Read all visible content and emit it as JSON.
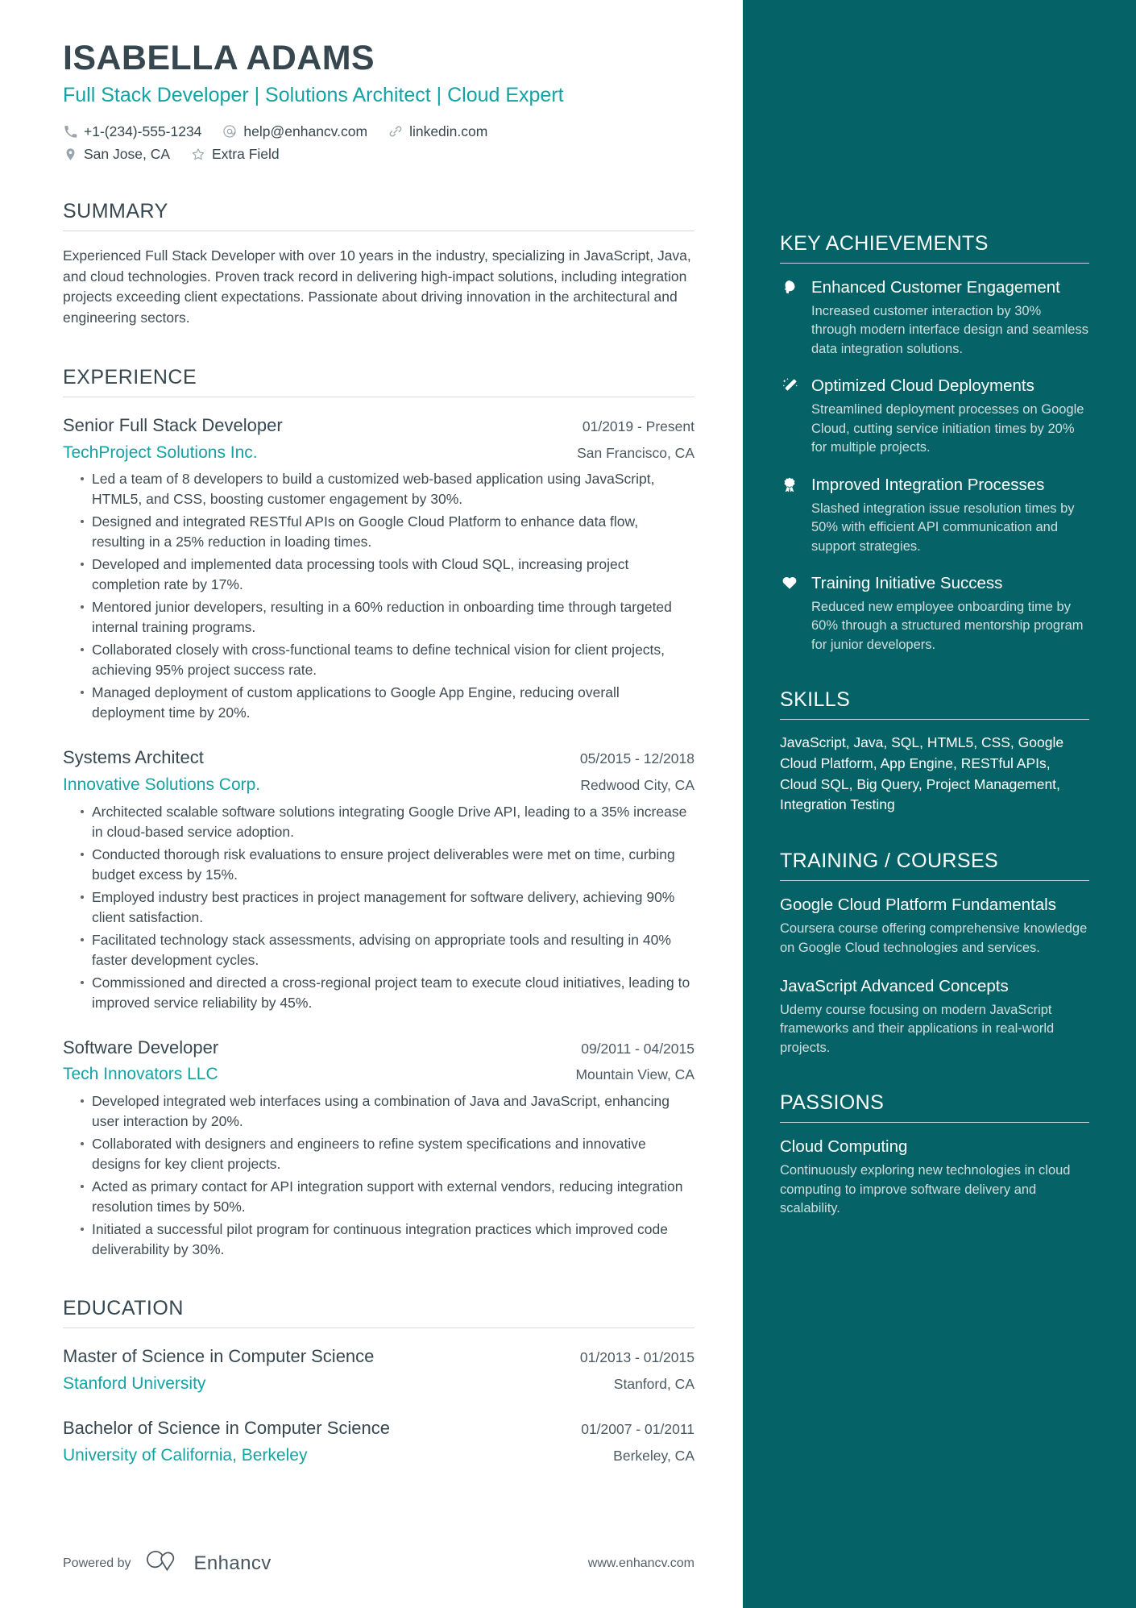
{
  "colors": {
    "accent_teal": "#14a3a3",
    "sidebar_bg": "#056367",
    "text_dark": "#37474f",
    "muted": "#cfdedd"
  },
  "header": {
    "name": "ISABELLA ADAMS",
    "headline": "Full Stack Developer | Solutions Architect | Cloud Expert",
    "contacts_row1": [
      {
        "icon": "phone-icon",
        "text": "+1-(234)-555-1234"
      },
      {
        "icon": "email-icon",
        "text": "help@enhancv.com"
      },
      {
        "icon": "link-icon",
        "text": "linkedin.com"
      }
    ],
    "contacts_row2": [
      {
        "icon": "location-icon",
        "text": "San Jose, CA"
      },
      {
        "icon": "star-icon",
        "text": "Extra Field"
      }
    ]
  },
  "summary": {
    "title": "SUMMARY",
    "text": "Experienced Full Stack Developer with over 10 years in the industry, specializing in JavaScript, Java, and cloud technologies. Proven track record in delivering high-impact solutions, including integration projects exceeding client expectations. Passionate about driving innovation in the architectural and engineering sectors."
  },
  "experience": {
    "title": "EXPERIENCE",
    "jobs": [
      {
        "title": "Senior Full Stack Developer",
        "dates": "01/2019 - Present",
        "company": "TechProject Solutions Inc.",
        "location": "San Francisco, CA",
        "bullets": [
          "Led a team of 8 developers to build a customized web-based application using JavaScript, HTML5, and CSS, boosting customer engagement by 30%.",
          "Designed and integrated RESTful APIs on Google Cloud Platform to enhance data flow, resulting in a 25% reduction in loading times.",
          "Developed and implemented data processing tools with Cloud SQL, increasing project completion rate by 17%.",
          "Mentored junior developers, resulting in a 60% reduction in onboarding time through targeted internal training programs.",
          "Collaborated closely with cross-functional teams to define technical vision for client projects, achieving 95% project success rate.",
          "Managed deployment of custom applications to Google App Engine, reducing overall deployment time by 20%."
        ]
      },
      {
        "title": "Systems Architect",
        "dates": "05/2015 - 12/2018",
        "company": "Innovative Solutions Corp.",
        "location": "Redwood City, CA",
        "bullets": [
          "Architected scalable software solutions integrating Google Drive API, leading to a 35% increase in cloud-based service adoption.",
          "Conducted thorough risk evaluations to ensure project deliverables were met on time, curbing budget excess by 15%.",
          "Employed industry best practices in project management for software delivery, achieving 90% client satisfaction.",
          "Facilitated technology stack assessments, advising on appropriate tools and resulting in 40% faster development cycles.",
          "Commissioned and directed a cross-regional project team to execute cloud initiatives, leading to improved service reliability by 45%."
        ]
      },
      {
        "title": "Software Developer",
        "dates": "09/2011 - 04/2015",
        "company": "Tech Innovators LLC",
        "location": "Mountain View, CA",
        "bullets": [
          "Developed integrated web interfaces using a combination of Java and JavaScript, enhancing user interaction by 20%.",
          "Collaborated with designers and engineers to refine system specifications and innovative designs for key client projects.",
          "Acted as primary contact for API integration support with external vendors, reducing integration resolution times by 50%.",
          "Initiated a successful pilot program for continuous integration practices which improved code deliverability by 30%."
        ]
      }
    ]
  },
  "education": {
    "title": "EDUCATION",
    "entries": [
      {
        "degree": "Master of Science in Computer Science",
        "dates": "01/2013 - 01/2015",
        "school": "Stanford University",
        "location": "Stanford, CA"
      },
      {
        "degree": "Bachelor of Science in Computer Science",
        "dates": "01/2007 - 01/2011",
        "school": "University of California, Berkeley",
        "location": "Berkeley, CA"
      }
    ]
  },
  "footer": {
    "powered_by": "Powered by",
    "brand": "Enhancv",
    "website": "www.enhancv.com"
  },
  "sidebar": {
    "achievements": {
      "title": "KEY ACHIEVEMENTS",
      "items": [
        {
          "icon": "head-profile-icon",
          "title": "Enhanced Customer Engagement",
          "desc": "Increased customer interaction by 30% through modern interface design and seamless data integration solutions."
        },
        {
          "icon": "magic-wand-icon",
          "title": "Optimized Cloud Deployments",
          "desc": "Streamlined deployment processes on Google Cloud, cutting service initiation times by 20% for multiple projects."
        },
        {
          "icon": "award-ribbon-icon",
          "title": "Improved Integration Processes",
          "desc": "Slashed integration issue resolution times by 50% with efficient API communication and support strategies."
        },
        {
          "icon": "heart-icon",
          "title": "Training Initiative Success",
          "desc": "Reduced new employee onboarding time by 60% through a structured mentorship program for junior developers."
        }
      ]
    },
    "skills": {
      "title": "SKILLS",
      "text": "JavaScript, Java, SQL, HTML5, CSS, Google Cloud Platform, App Engine, RESTful APIs, Cloud SQL, Big Query, Project Management, Integration Testing"
    },
    "training": {
      "title": "TRAINING / COURSES",
      "courses": [
        {
          "title": "Google Cloud Platform Fundamentals",
          "desc": "Coursera course offering comprehensive knowledge on Google Cloud technologies and services."
        },
        {
          "title": "JavaScript Advanced Concepts",
          "desc": "Udemy course focusing on modern JavaScript frameworks and their applications in real-world projects."
        }
      ]
    },
    "passions": {
      "title": "PASSIONS",
      "items": [
        {
          "title": "Cloud Computing",
          "desc": "Continuously exploring new technologies in cloud computing to improve software delivery and scalability."
        }
      ]
    }
  }
}
